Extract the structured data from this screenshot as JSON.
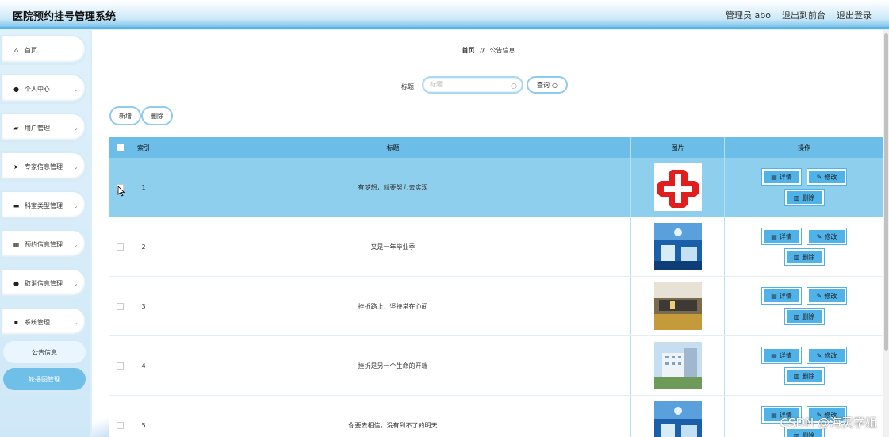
{
  "header": {
    "app_title": "医院预约挂号管理系统",
    "admin_label": "管理员 abo",
    "frontend_link": "退出到前台",
    "logout_link": "退出登录"
  },
  "sidebar": {
    "items": [
      {
        "label": "首页",
        "icon": "home-icon"
      },
      {
        "label": "个人中心",
        "icon": "user-icon"
      },
      {
        "label": "用户管理",
        "icon": "hand-icon"
      },
      {
        "label": "专家信息管理",
        "icon": "send-icon"
      },
      {
        "label": "科室类型管理",
        "icon": "monitor-icon"
      },
      {
        "label": "预约信息管理",
        "icon": "grid-icon"
      },
      {
        "label": "取消信息管理",
        "icon": "pin-icon"
      },
      {
        "label": "系统管理",
        "icon": "apps-icon"
      }
    ],
    "sub_items": [
      {
        "label": "公告信息",
        "active": false
      },
      {
        "label": "轮播图管理",
        "active": true
      }
    ]
  },
  "breadcrumb": {
    "home": "首页",
    "sep": "//",
    "current": "公告信息"
  },
  "search": {
    "label": "标题",
    "placeholder": "标题",
    "query_button": "查询"
  },
  "actions": {
    "add_label": "新增",
    "delete_label": "删除"
  },
  "table": {
    "headers": {
      "index": "索引",
      "title": "标题",
      "image": "图片",
      "ops": "操作"
    },
    "buttons": {
      "detail": "详情",
      "edit": "修改",
      "delete": "删除"
    },
    "rows": [
      {
        "index": "1",
        "title": "有梦想，就要努力去实现",
        "image": "red-cross",
        "highlighted": true
      },
      {
        "index": "2",
        "title": "又是一年毕业季",
        "image": "ward-blue",
        "highlighted": false
      },
      {
        "index": "3",
        "title": "挫折路上，坚持常在心间",
        "image": "hall-interior",
        "highlighted": false
      },
      {
        "index": "4",
        "title": "挫折是另一个生命的开端",
        "image": "hospital-building",
        "highlighted": false
      },
      {
        "index": "5",
        "title": "你要去相信，没有到不了的明天",
        "image": "ward-blue",
        "highlighted": false
      }
    ]
  },
  "watermark": "CSDN @海灵学姐",
  "colors": {
    "accent": "#6dbde9",
    "header_bg": "#cde9f8",
    "button": "#4fb3ea",
    "highlight_row": "#8fcfee"
  }
}
